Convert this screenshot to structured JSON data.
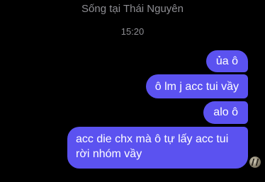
{
  "header": {
    "location": "Sống tại Thái Nguyên"
  },
  "timestamp": "15:20",
  "messages": [
    {
      "text": "ủa ô"
    },
    {
      "text": "ô lm j acc tui vầy"
    },
    {
      "text": "alo ô"
    },
    {
      "text": "acc die chx mà ô tự lấy acc tui rời nhóm vầy"
    }
  ],
  "colors": {
    "background": "#000000",
    "outgoing_bubble": "#5b52f0",
    "meta_text": "#8e8e93"
  }
}
